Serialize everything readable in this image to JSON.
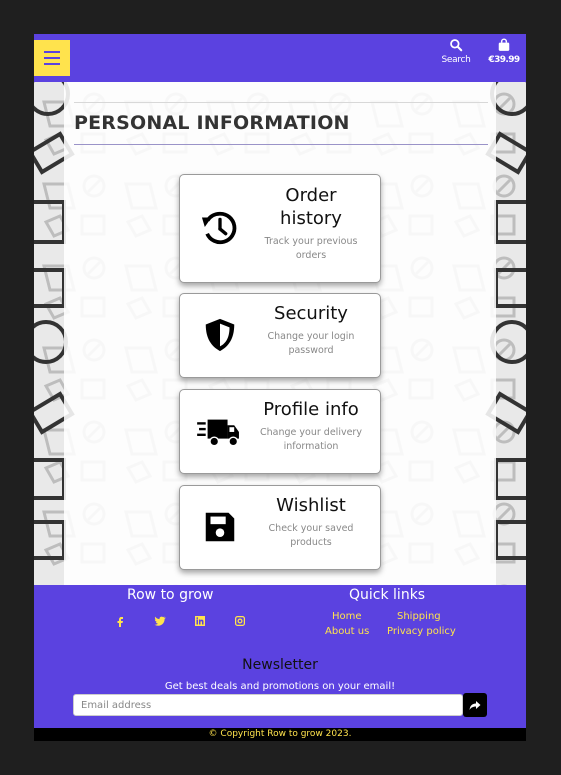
{
  "header": {
    "search_label": "Search",
    "bag_total": "€39.99"
  },
  "page": {
    "title": "PERSONAL INFORMATION"
  },
  "cards": [
    {
      "title": "Order history",
      "subtitle": "Track your previous orders",
      "icon": "history-icon"
    },
    {
      "title": "Security",
      "subtitle": "Change your login password",
      "icon": "shield-icon"
    },
    {
      "title": "Profile info",
      "subtitle": "Change your delivery information",
      "icon": "delivery-truck-icon"
    },
    {
      "title": "Wishlist",
      "subtitle": "Check your saved products",
      "icon": "floppy-disk-icon"
    }
  ],
  "footer": {
    "brand": "Row to grow",
    "socials": [
      "facebook-icon",
      "twitter-icon",
      "linkedin-icon",
      "instagram-icon"
    ],
    "quick_links_title": "Quick links",
    "links": {
      "home": "Home",
      "shipping": "Shipping",
      "about": "About us",
      "privacy": "Privacy policy"
    },
    "newsletter_title": "Newsletter",
    "newsletter_sub": "Get best deals and promotions on your email!",
    "email_placeholder": "Email address",
    "copyright": "© Copyright Row to grow 2023."
  },
  "colors": {
    "brand": "#5b42e0",
    "accent": "#ffe34d",
    "background": "#1f1f1f"
  }
}
